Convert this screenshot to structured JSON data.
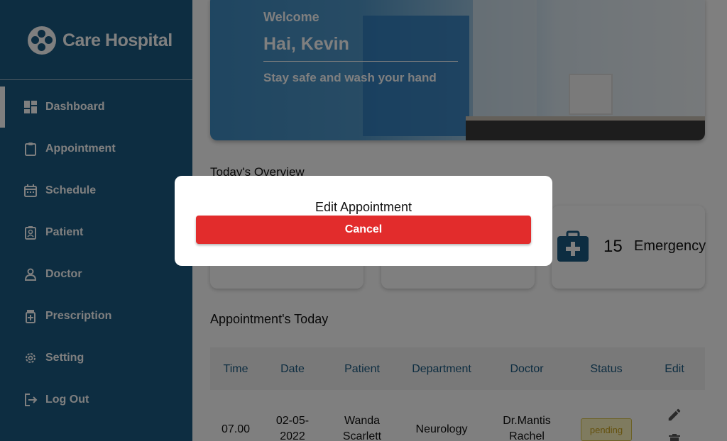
{
  "sidebar": {
    "brand": "Care Hospital",
    "items": [
      {
        "label": "Dashboard",
        "icon": "dashboard-icon",
        "active": true
      },
      {
        "label": "Appointment",
        "icon": "clipboard-icon"
      },
      {
        "label": "Schedule",
        "icon": "calendar-icon"
      },
      {
        "label": "Patient",
        "icon": "patient-id-icon"
      },
      {
        "label": "Doctor",
        "icon": "person-icon"
      },
      {
        "label": "Prescription",
        "icon": "medicine-bottle-icon"
      },
      {
        "label": "Setting",
        "icon": "gear-icon"
      },
      {
        "label": "Log Out",
        "icon": "logout-icon"
      }
    ]
  },
  "hero": {
    "welcome": "Welcome",
    "greeting": "Hai, Kevin",
    "tagline": "Stay safe and wash your hand"
  },
  "overview": {
    "title": "Today's Overview",
    "cards": [
      {
        "count": "15",
        "label": "Emergency",
        "icon": "first-aid-kit-icon"
      }
    ]
  },
  "appointments": {
    "title": "Appointment's Today",
    "columns": [
      "Time",
      "Date",
      "Patient",
      "Department",
      "Doctor",
      "Status",
      "Edit"
    ],
    "rows": [
      {
        "time": "07.00",
        "date_line1": "02-05-",
        "date_line2": "2022",
        "patient_line1": "Wanda",
        "patient_line2": "Scarlett",
        "department": "Neurology",
        "doctor_line1": "Dr.Mantis",
        "doctor_line2": "Rachel",
        "status": "pending"
      }
    ]
  },
  "modal": {
    "title": "Edit Appointment",
    "cancel_label": "Cancel"
  },
  "colors": {
    "sidebar": "#1b5a82",
    "cancel": "#e22c2c",
    "pending_bg": "#fff6bf"
  }
}
